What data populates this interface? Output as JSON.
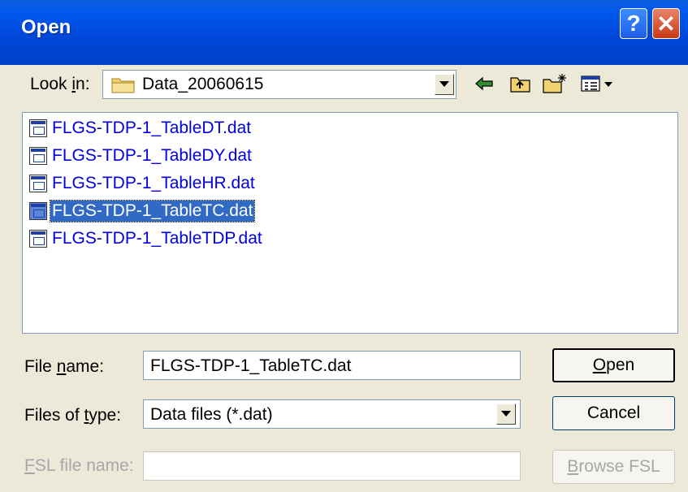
{
  "window": {
    "title": "Open",
    "help_glyph": "?",
    "close_glyph": "✕"
  },
  "lookin": {
    "label_pre": "Look ",
    "label_u": "i",
    "label_post": "n:",
    "value": "Data_20060615"
  },
  "files": [
    {
      "name": "FLGS-TDP-1_TableDT.dat",
      "selected": false
    },
    {
      "name": "FLGS-TDP-1_TableDY.dat",
      "selected": false
    },
    {
      "name": "FLGS-TDP-1_TableHR.dat",
      "selected": false
    },
    {
      "name": "FLGS-TDP-1_TableTC.dat",
      "selected": true
    },
    {
      "name": "FLGS-TDP-1_TableTDP.dat",
      "selected": false
    }
  ],
  "filename": {
    "label_pre": "File ",
    "label_u": "n",
    "label_post": "ame:",
    "value": "FLGS-TDP-1_TableTC.dat"
  },
  "filetype": {
    "label_pre": "Files of ",
    "label_u": "t",
    "label_post": "ype:",
    "value": "Data files (*.dat)"
  },
  "fslname": {
    "label_u": "F",
    "label_post": "SL file name:",
    "value": ""
  },
  "buttons": {
    "open_u": "O",
    "open_post": "pen",
    "cancel": "Cancel",
    "browse_u": "B",
    "browse_post": "rowse FSL"
  }
}
